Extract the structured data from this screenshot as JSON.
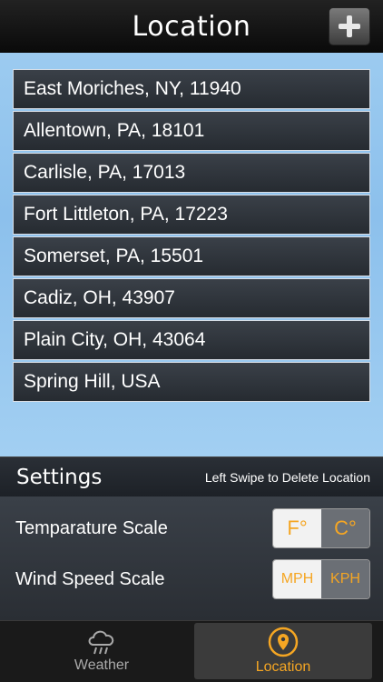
{
  "header": {
    "title": "Location"
  },
  "locations": [
    "East Moriches, NY, 11940",
    "Allentown, PA, 18101",
    "Carlisle, PA, 17013",
    "Fort Littleton, PA, 17223",
    "Somerset, PA, 15501",
    "Cadiz, OH, 43907",
    "Plain City, OH, 43064",
    "Spring Hill, USA"
  ],
  "settings": {
    "title": "Settings",
    "hint": "Left Swipe to Delete Location",
    "temperature": {
      "label": "Temparature Scale",
      "options": [
        "F°",
        "C°"
      ],
      "selected": "F°"
    },
    "wind": {
      "label": "Wind Speed Scale",
      "options": [
        "MPH",
        "KPH"
      ],
      "selected": "MPH"
    }
  },
  "tabs": [
    {
      "label": "Weather",
      "icon": "cloud-rain-icon",
      "active": false
    },
    {
      "label": "Location",
      "icon": "map-pin-icon",
      "active": true
    }
  ],
  "colors": {
    "accent": "#f5a623",
    "sky": "#9ccbf0"
  }
}
